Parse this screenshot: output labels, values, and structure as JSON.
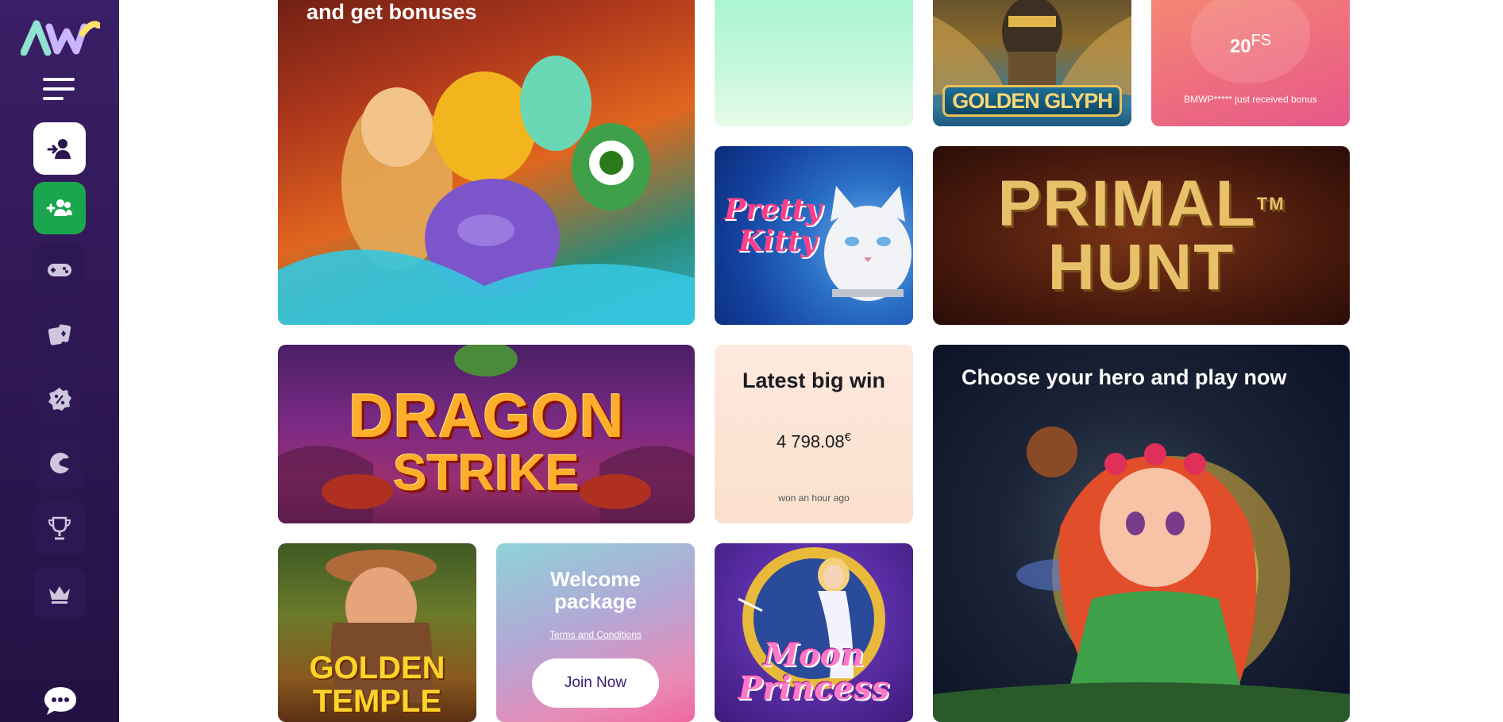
{
  "sidebar": {
    "logo": "AW",
    "menu_icon": "hamburger-icon",
    "buttons": [
      {
        "icon": "user-login-icon",
        "style": "white"
      },
      {
        "icon": "users-add-icon",
        "style": "green"
      },
      {
        "icon": "gamepad-icon",
        "style": "dark"
      },
      {
        "icon": "cards-icon",
        "style": "dark"
      },
      {
        "icon": "percent-badge-icon",
        "style": "dark"
      },
      {
        "icon": "pacman-icon",
        "style": "dark"
      },
      {
        "icon": "trophy-icon",
        "style": "dark"
      },
      {
        "icon": "crown-icon",
        "style": "dark"
      }
    ],
    "chat_icon": "chat-bubble-icon"
  },
  "tiles": {
    "hero_banner": {
      "text": "and get bonuses"
    },
    "golden_glyph": {
      "title": "GOLDEN GLYPH"
    },
    "free_spins": {
      "value": "20",
      "unit": "FS",
      "message": "BMWP***** just received bonus"
    },
    "pretty_kitty": {
      "line1": "Pretty",
      "line2": "Kitty"
    },
    "primal_hunt": {
      "line1": "PRIMAL",
      "tm": "TM",
      "line2": "HUNT"
    },
    "dragon_strike": {
      "line1": "DRAGON",
      "line2": "STRIKE"
    },
    "latest_win": {
      "title": "Latest big win",
      "amount": "4 798.08",
      "currency": "€",
      "when": "won an hour ago"
    },
    "hero_choose": {
      "title": "Choose your hero and play now"
    },
    "golden_temple": {
      "line1": "GOLDEN",
      "line2": "TEMPLE"
    },
    "welcome": {
      "title_line1": "Welcome",
      "title_line2": "package",
      "terms": "Terms and Conditions",
      "button": "Join Now"
    },
    "moon_princess": {
      "line1": "Moon",
      "line2": "Princess"
    }
  },
  "colors": {
    "sidebar": "#2c1650",
    "accent_green": "#19a64d",
    "button_text": "#3a2076"
  }
}
